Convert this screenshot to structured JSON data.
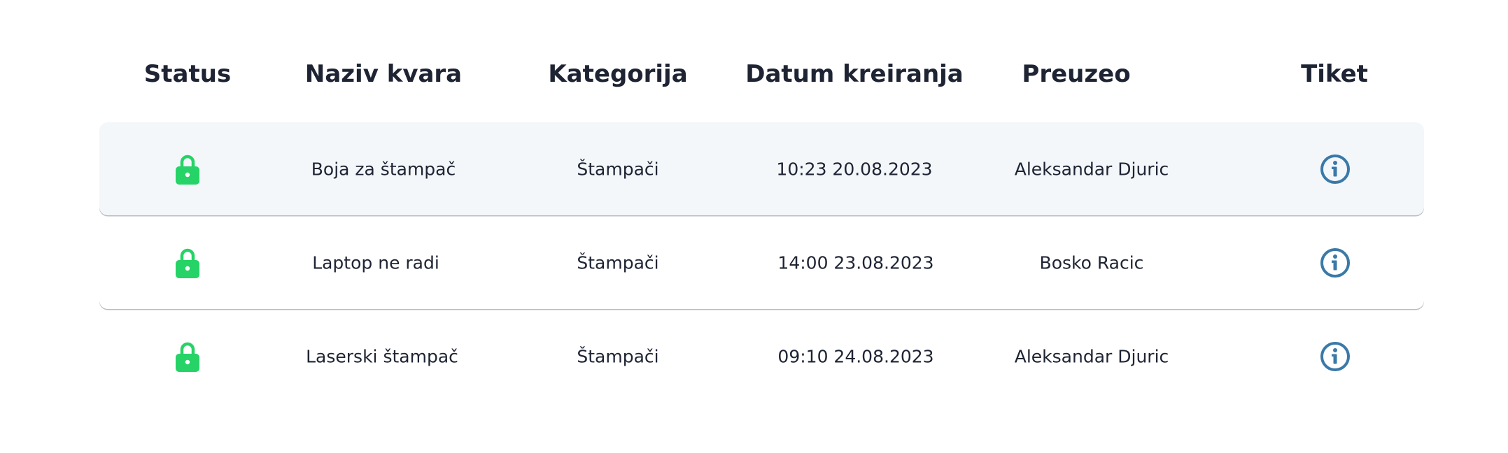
{
  "table": {
    "headers": {
      "status": "Status",
      "naziv": "Naziv kvara",
      "kategorija": "Kategorija",
      "datum": "Datum kreiranja",
      "preuzeo": "Preuzeo",
      "tiket": "Tiket"
    },
    "rows": [
      {
        "status_icon": "lock-icon",
        "naziv": "Boja za štampač",
        "kategorija": "Štampači",
        "datum": "10:23 20.08.2023",
        "preuzeo": "Aleksandar Djuric",
        "tiket_icon": "info-icon"
      },
      {
        "status_icon": "lock-icon",
        "naziv": "Laptop ne radi",
        "kategorija": "Štampači",
        "datum": "14:00 23.08.2023",
        "preuzeo": "Bosko Racic",
        "tiket_icon": "info-icon"
      },
      {
        "status_icon": "lock-icon",
        "naziv": "Laserski štampač",
        "kategorija": "Štampači",
        "datum": "09:10 24.08.2023",
        "preuzeo": "Aleksandar Djuric",
        "tiket_icon": "info-icon"
      }
    ]
  },
  "colors": {
    "lock": "#25d366",
    "info": "#3a79a8",
    "text": "#1e2433",
    "row_highlight": "#f3f7fa"
  }
}
